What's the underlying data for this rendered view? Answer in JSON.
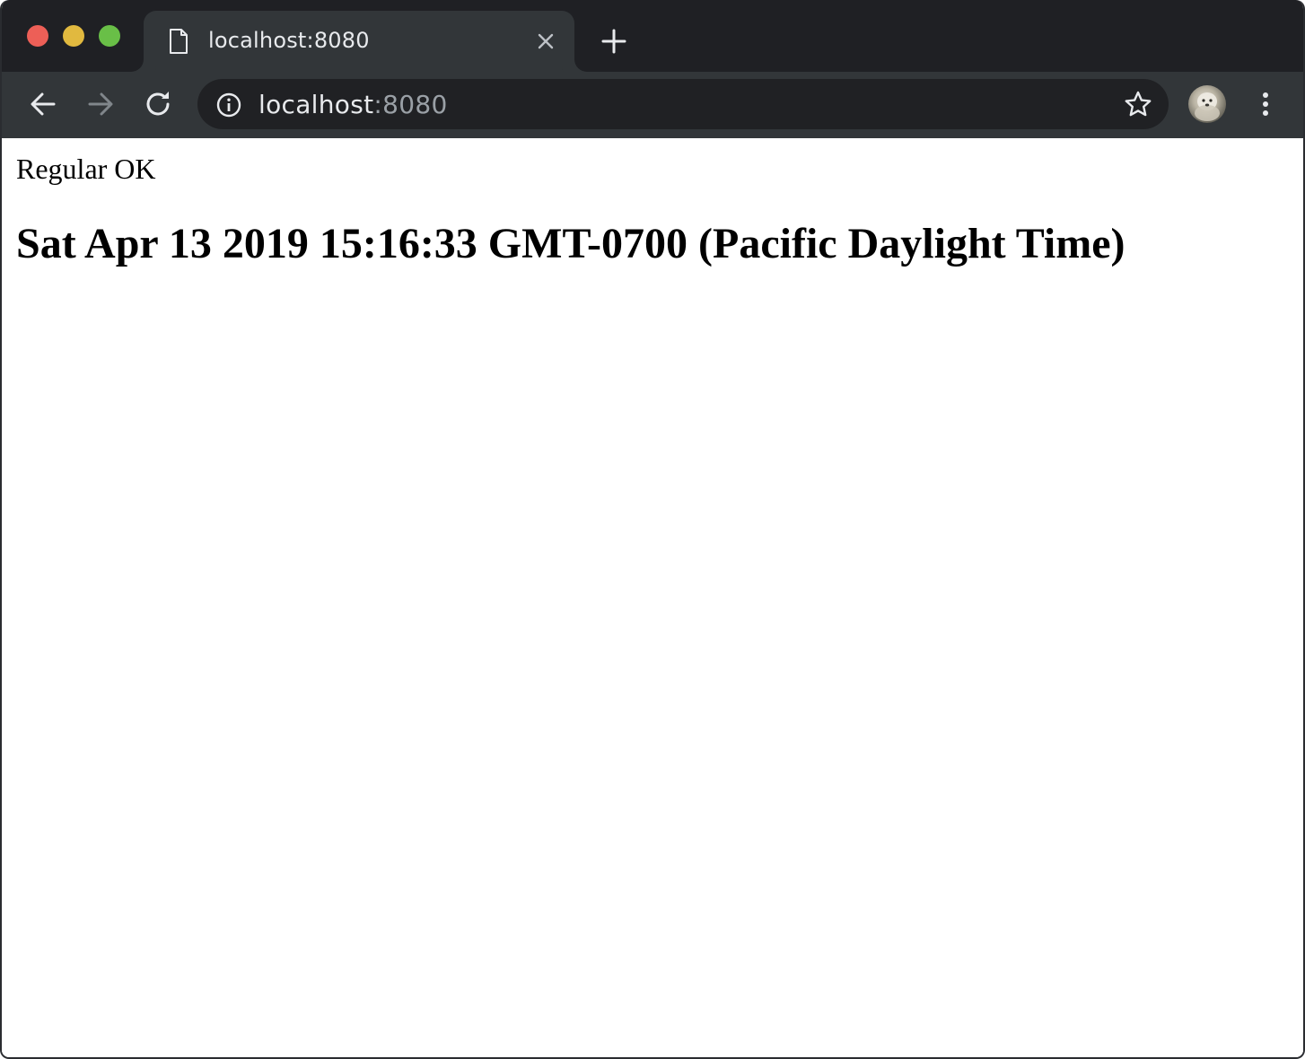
{
  "browser": {
    "tab": {
      "title": "localhost:8080"
    },
    "address_bar": {
      "host": "localhost",
      "port": ":8080"
    },
    "icons": {
      "tab": "document-icon",
      "close": "close-icon",
      "new_tab": "plus-icon",
      "back": "arrow-left-icon",
      "forward": "arrow-right-icon",
      "reload": "reload-icon",
      "site_info": "info-icon",
      "bookmark": "star-icon",
      "menu": "kebab-menu-icon"
    },
    "colors": {
      "frame": "#1f2024",
      "toolbar": "#323639",
      "omnibox": "#202124",
      "text": "#e8eaed",
      "muted": "#9aa0a6"
    }
  },
  "page": {
    "status_text": "Regular OK",
    "date_heading": "Sat Apr 13 2019 15:16:33 GMT-0700 (Pacific Daylight Time)"
  }
}
